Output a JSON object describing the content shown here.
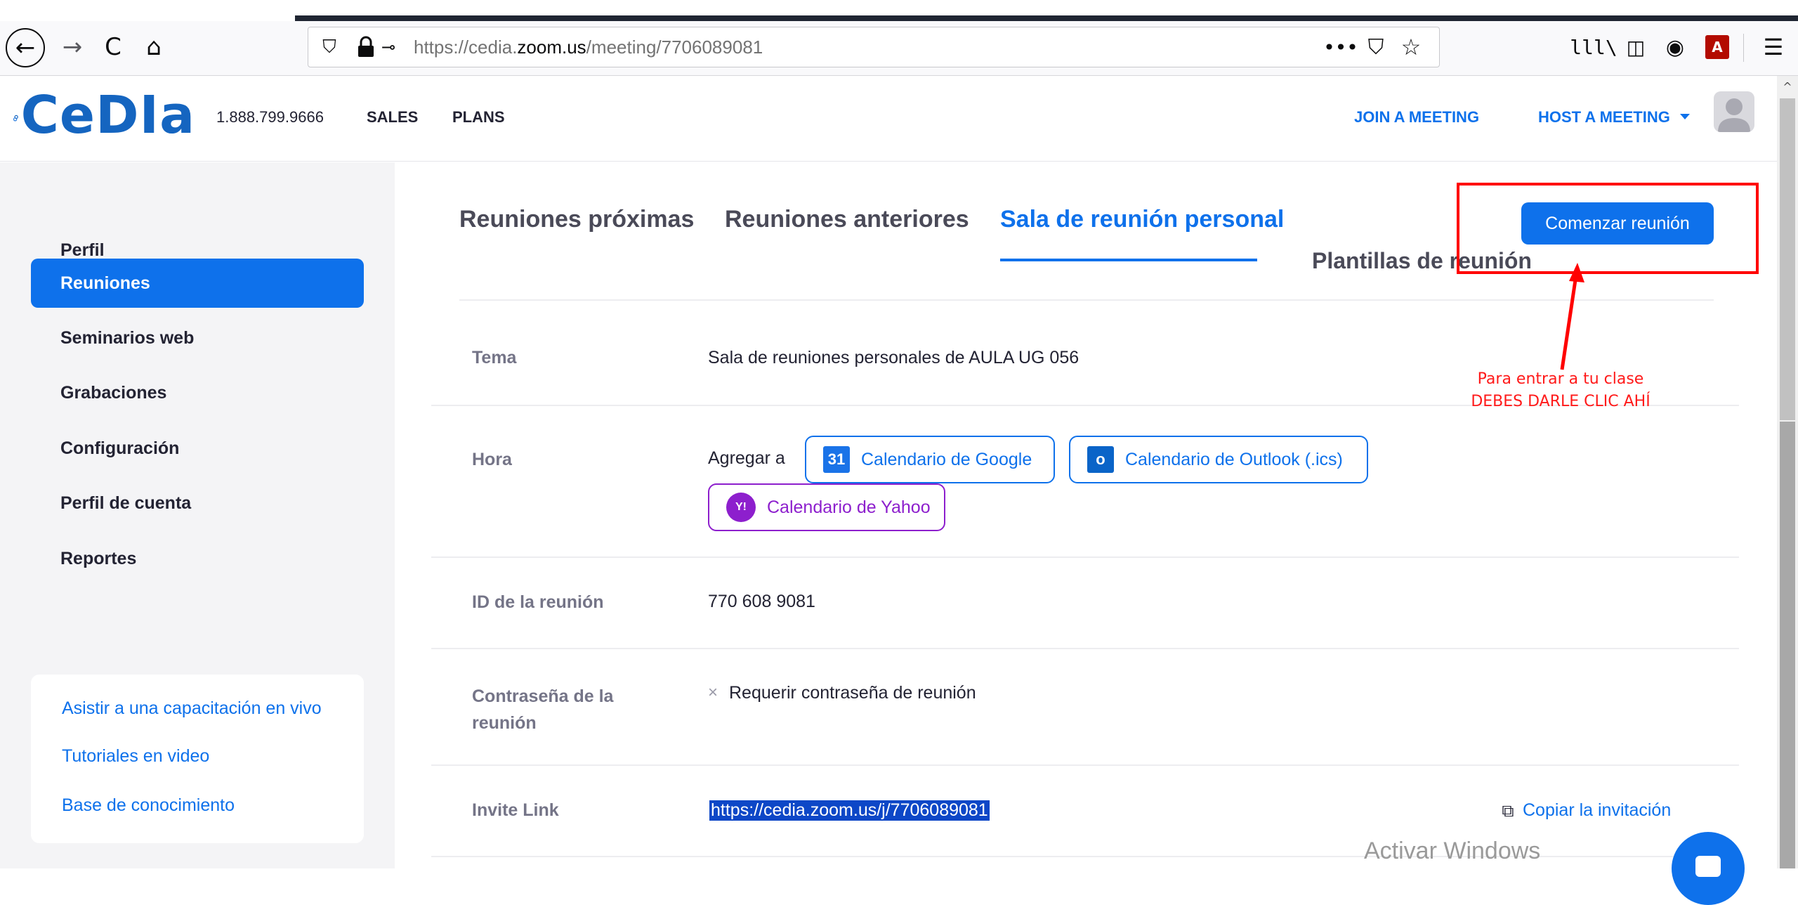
{
  "browser": {
    "url_prefix": "https://cedia.",
    "url_domain": "zoom.us",
    "url_path": "/meeting/7706089081",
    "icons": {
      "back": "←",
      "forward": "→",
      "reload": "C",
      "home": "⌂",
      "shield": "⛉",
      "key": "⊸",
      "page_actions": "•••",
      "pocket": "⛉",
      "star": "☆",
      "library": "lll\\",
      "sidebar": "◫",
      "account": "◉",
      "pdf": "A",
      "menu": "☰"
    }
  },
  "header": {
    "logo_text": "CeDIa",
    "phone": "1.888.799.9666",
    "sales": "SALES",
    "plans": "PLANS",
    "join_meeting": "JOIN A MEETING",
    "host_meeting": "HOST A MEETING"
  },
  "sidebar": {
    "items": [
      {
        "label": "Perfil"
      },
      {
        "label": "Reuniones"
      },
      {
        "label": "Seminarios web"
      },
      {
        "label": "Grabaciones"
      },
      {
        "label": "Configuración"
      },
      {
        "label": "Perfil de cuenta"
      },
      {
        "label": "Reportes"
      }
    ],
    "help": [
      {
        "label": "Asistir a una capacitación en vivo"
      },
      {
        "label": "Tutoriales en video"
      },
      {
        "label": "Base de conocimiento"
      }
    ]
  },
  "main": {
    "tabs": [
      {
        "label": "Reuniones próximas"
      },
      {
        "label": "Reuniones anteriores"
      },
      {
        "label": "Sala de reunión personal"
      },
      {
        "label": "Plantillas de reunión"
      }
    ],
    "start_button": "Comenzar reunión",
    "rows": {
      "topic_label": "Tema",
      "topic_value": "Sala de reuniones personales de AULA UG 056",
      "time_label": "Hora",
      "add_to": "Agregar a",
      "google_calendar": "Calendario de Google",
      "google_icon_text": "31",
      "outlook_calendar": "Calendario de Outlook (.ics)",
      "outlook_icon_text": "o",
      "yahoo_calendar": "Calendario de Yahoo",
      "yahoo_icon_text": "Y!",
      "meeting_id_label": "ID de la reunión",
      "meeting_id_value": "770 608 9081",
      "password_label": "Contraseña de la reunión",
      "password_x": "×",
      "password_value": "Requerir contraseña de reunión",
      "invite_label": "Invite Link",
      "invite_value": "https://cedia.zoom.us/j/7706089081",
      "copy_invite": "Copiar la invitación",
      "copy_icon": "⧉"
    }
  },
  "annotation": {
    "line1": "Para entrar a tu clase",
    "line2": "DEBES DARLE CLIC AHÍ",
    "color": "#ff0000"
  },
  "watermark": "Activar Windows",
  "colors": {
    "accent": "#0e71eb",
    "yahoo": "#8d1fcd",
    "sidebar_bg": "#f4f4f6"
  }
}
